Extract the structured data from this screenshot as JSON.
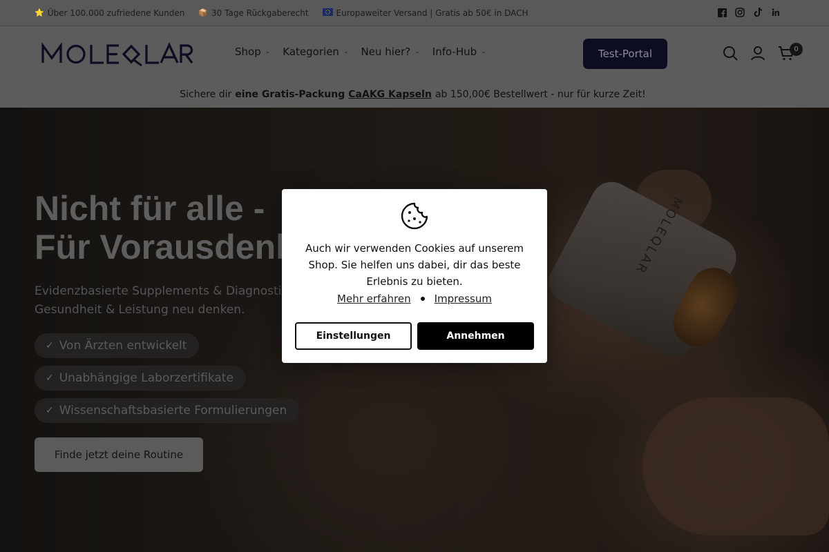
{
  "topbar": {
    "usps": [
      {
        "icon": "star-emoji",
        "text": "Über 100.000 zufriedene Kunden"
      },
      {
        "icon": "package-emoji",
        "text": "30 Tage Rückgaberecht"
      },
      {
        "icon": "eu-flag-emoji",
        "text": "Europaweiter Versand | Gratis ab 50€ in DACH"
      }
    ],
    "socials": [
      "facebook-icon",
      "instagram-icon",
      "tiktok-icon",
      "linkedin-icon"
    ]
  },
  "header": {
    "logo": "MOLEQLAR",
    "nav": [
      "Shop",
      "Kategorien",
      "Neu hier?",
      "Info-Hub"
    ],
    "portal_button": "Test-Portal",
    "cart_count": "0"
  },
  "promo": {
    "prefix": "Sichere dir",
    "bold": "eine Gratis-Packung",
    "link": "CaAKG Kapseln",
    "suffix": "ab 150,00€ Bestellwert - nur für kurze Zeit!"
  },
  "hero": {
    "title_line1": "Nicht für alle -",
    "title_line2": "Für Vorausdenker.",
    "subtitle_line1": "Evidenzbasierte Supplements & Diagnostik",
    "subtitle_line2": "Gesundheit & Leistung neu denken.",
    "checks": [
      "Von Ärzten entwickelt",
      "Unabhängige Laborzertifikate",
      "Wissenschaftsbasierte Formulierungen"
    ],
    "cta": "Finde jetzt deine Routine",
    "bottle_label": "MOLEQLAR"
  },
  "cookie_modal": {
    "text": "Auch wir verwenden Cookies auf unserem Shop. Sie helfen uns dabei, dir das beste Erlebnis zu bieten.",
    "link_more": "Mehr erfahren",
    "link_imprint": "Impressum",
    "btn_settings": "Einstellungen",
    "btn_accept": "Annehmen"
  },
  "colors": {
    "modal_bg": "#ffffff",
    "accept_bg": "#000000",
    "portal_bg": "#0d0d22",
    "overlay_header": "#5c5c5c"
  }
}
